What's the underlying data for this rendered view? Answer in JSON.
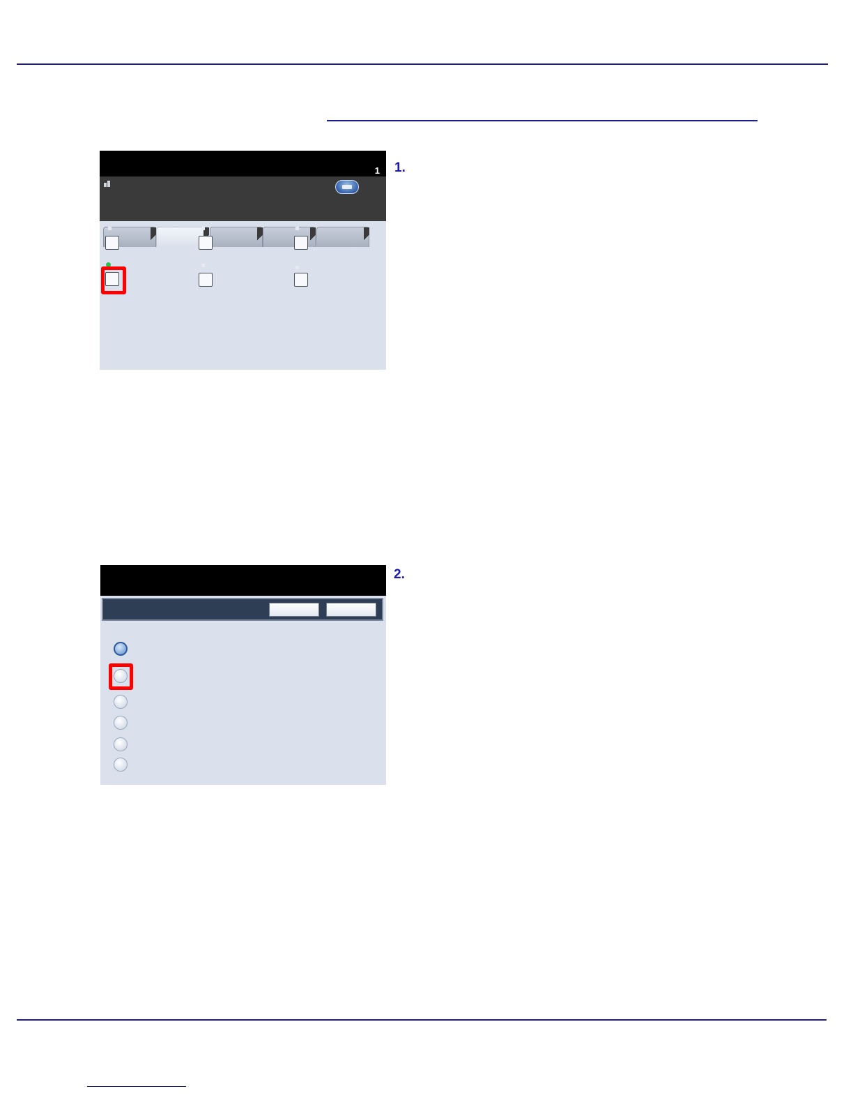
{
  "page": {
    "screen1": {
      "counter": "1",
      "tabs": [
        "",
        "",
        "",
        "",
        ""
      ],
      "active_tab": 1,
      "checkbox_rows": 2,
      "checkbox_cols": 3,
      "highlighted_checkbox": "row2-col1"
    },
    "screen2": {
      "buttons": [
        "",
        ""
      ],
      "radio_count": 6,
      "selected_radio": 1,
      "highlighted_radio": 2
    },
    "steps": [
      {
        "number": "1."
      },
      {
        "number": "2."
      }
    ],
    "colors": {
      "rule": "#1c1c8c",
      "step_number": "#1a1aa8",
      "highlight": "#ff0000",
      "panel_bg": "#dbe1ec",
      "indicator_on": "#2fbf4e"
    }
  }
}
